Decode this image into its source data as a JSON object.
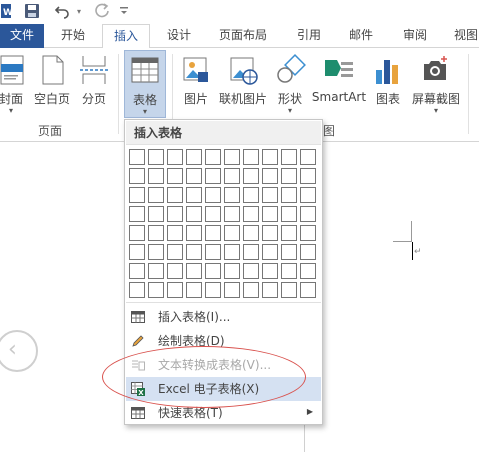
{
  "tabs": [
    "文件",
    "开始",
    "插入",
    "设计",
    "页面布局",
    "引用",
    "邮件",
    "审阅",
    "视图"
  ],
  "active_tab": "插入",
  "ribbon": {
    "buttons": [
      "封面",
      "空白页",
      "分页",
      "表格",
      "图片",
      "联机图片",
      "形状",
      "SmartArt",
      "图表",
      "屏幕截图"
    ],
    "groups": {
      "pages": "页面",
      "illustrations_partial": "图"
    }
  },
  "dropdown": {
    "header": "插入表格",
    "grid": {
      "rows": 8,
      "cols": 10
    },
    "items": [
      {
        "label": "插入表格(I)...",
        "enabled": true
      },
      {
        "label": "绘制表格(D)",
        "enabled": true
      },
      {
        "label": "文本转换成表格(V)...",
        "enabled": false
      },
      {
        "label": "Excel 电子表格(X)",
        "enabled": true,
        "highlighted": true
      },
      {
        "label": "快速表格(T)",
        "enabled": true,
        "submenu": true
      }
    ]
  },
  "annotation_color": "#d9534f",
  "accent_color": "#2b579a"
}
